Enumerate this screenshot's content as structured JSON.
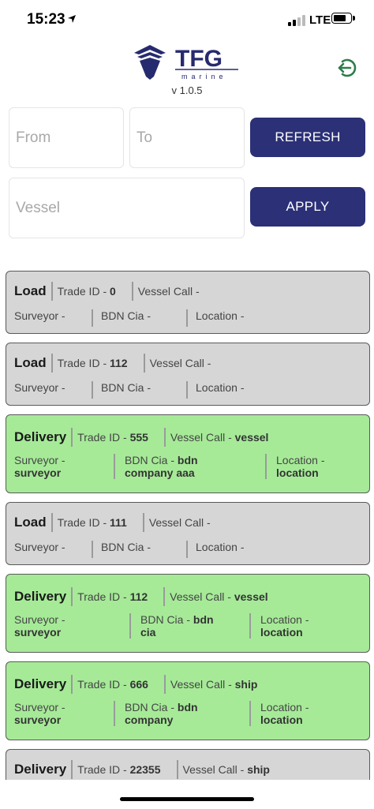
{
  "status_bar": {
    "time": "15:23",
    "network": "LTE",
    "battery_level_percent": 80
  },
  "header": {
    "version": "v 1.0.5",
    "logo_text": "TFG",
    "logo_subtext": "marine"
  },
  "filters": {
    "from_placeholder": "From",
    "to_placeholder": "To",
    "vessel_placeholder": "Vessel",
    "refresh_label": "REFRESH",
    "apply_label": "APPLY"
  },
  "labels": {
    "trade_id": "Trade ID - ",
    "vessel_call": "Vessel Call - ",
    "surveyor": "Surveyor - ",
    "bdn_cia": "BDN Cia - ",
    "location": "Location - "
  },
  "colors": {
    "accent": "#2b3077",
    "delivery_bg": "#a6ea98",
    "load_bg": "#d6d6d6",
    "logout": "#2e7d4a"
  },
  "cards": [
    {
      "type": "Load",
      "status": "gray",
      "trade_id": "0",
      "vessel_call": "",
      "surveyor": "",
      "bdn_cia": "",
      "location": ""
    },
    {
      "type": "Load",
      "status": "gray",
      "trade_id": "112",
      "vessel_call": "",
      "surveyor": "",
      "bdn_cia": "",
      "location": ""
    },
    {
      "type": "Delivery",
      "status": "green",
      "trade_id": "555",
      "vessel_call": "vessel",
      "surveyor": "surveyor",
      "bdn_cia": "bdn company aaa",
      "location": "location"
    },
    {
      "type": "Load",
      "status": "gray",
      "trade_id": "111",
      "vessel_call": "",
      "surveyor": "",
      "bdn_cia": "",
      "location": ""
    },
    {
      "type": "Delivery",
      "status": "green",
      "trade_id": "112",
      "vessel_call": "vessel",
      "surveyor": "surveyor",
      "bdn_cia": "bdn cia",
      "location": "location"
    },
    {
      "type": "Delivery",
      "status": "green",
      "trade_id": "666",
      "vessel_call": "ship",
      "surveyor": "surveyor",
      "bdn_cia": "bdn company",
      "location": "location"
    },
    {
      "type": "Delivery",
      "status": "gray",
      "trade_id": "22355",
      "vessel_call": "ship",
      "surveyor": "",
      "bdn_cia": "",
      "location": ""
    }
  ]
}
